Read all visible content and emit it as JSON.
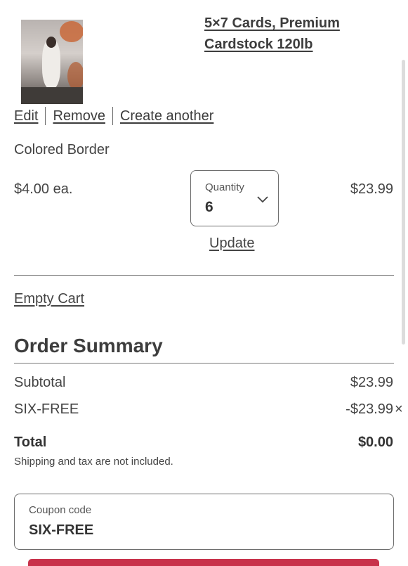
{
  "product": {
    "title": "5×7 Cards, Premium Cardstock 120lb",
    "actions": {
      "edit": "Edit",
      "remove": "Remove",
      "create_another": "Create another"
    },
    "variant": "Colored Border",
    "unit_price": "$4.00 ea.",
    "line_total": "$23.99",
    "quantity": {
      "label": "Quantity",
      "value": "6"
    },
    "update_label": "Update"
  },
  "cart": {
    "empty_label": "Empty Cart"
  },
  "summary": {
    "heading": "Order Summary",
    "subtotal_label": "Subtotal",
    "subtotal_value": "$23.99",
    "discount_label": "SIX-FREE",
    "discount_value": "-$23.99",
    "total_label": "Total",
    "total_value": "$0.00",
    "note": "Shipping and tax are not included."
  },
  "coupon": {
    "label": "Coupon code",
    "value": "SIX-FREE"
  },
  "colors": {
    "text": "#3c3c3c",
    "divider": "#7a7a7a",
    "button_accent": "#c8324b"
  },
  "icons": {
    "quantity": "chevron-down-icon",
    "discount_remove": "close-icon"
  }
}
